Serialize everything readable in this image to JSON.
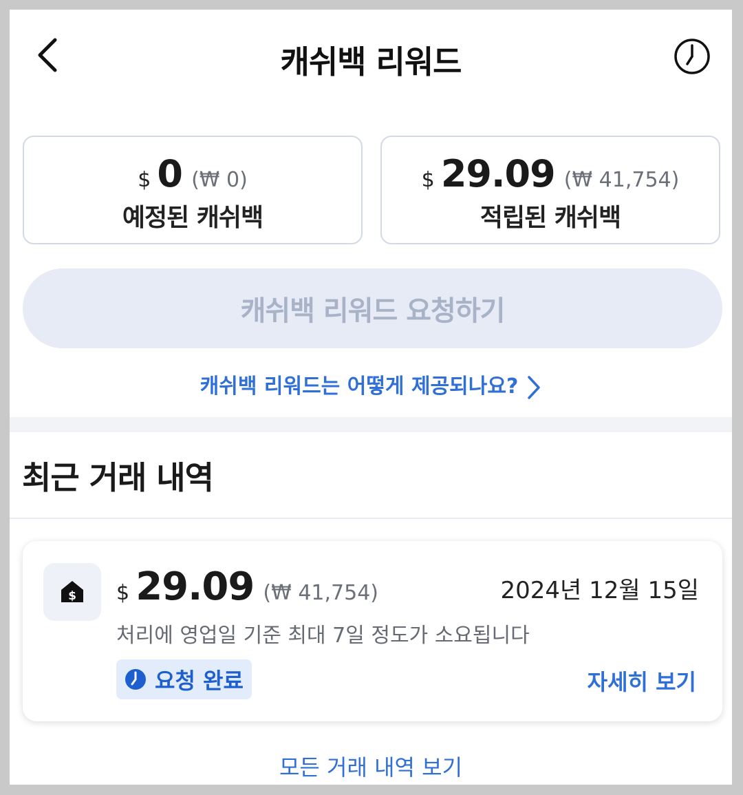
{
  "header": {
    "title": "캐쉬백 리워드",
    "back_icon": "chevron-left-icon",
    "history_icon": "clock-icon"
  },
  "summary": {
    "scheduled": {
      "currency_symbol": "$",
      "amount": "0",
      "krw": "(₩ 0)",
      "label": "예정된 캐쉬백"
    },
    "accumulated": {
      "currency_symbol": "$",
      "amount": "29.09",
      "krw": "(₩ 41,754)",
      "label": "적립된 캐쉬백"
    }
  },
  "request_button": {
    "label": "캐쉬백 리워드 요청하기",
    "enabled": false
  },
  "help_link": {
    "label": "캐쉬백 리워드는 어떻게 제공되나요?",
    "icon": "chevron-right-icon"
  },
  "recent": {
    "title": "최근 거래 내역",
    "transactions": [
      {
        "icon": "cash-tag-icon",
        "currency_symbol": "$",
        "amount": "29.09",
        "krw": "(₩ 41,754)",
        "date": "2024년 12월 15일",
        "note": "처리에 영업일 기준 최대 7일 정도가 소요됩니다",
        "status": "요청 완료",
        "status_icon": "clock-filled-icon",
        "detail_label": "자세히 보기"
      }
    ],
    "view_all_label": "모든 거래 내역 보기"
  },
  "colors": {
    "accent": "#2f6fd6",
    "status_badge_bg": "#e3ecfb",
    "disabled_button_bg": "#e6ebf6",
    "disabled_button_text": "#a8b3c7"
  }
}
